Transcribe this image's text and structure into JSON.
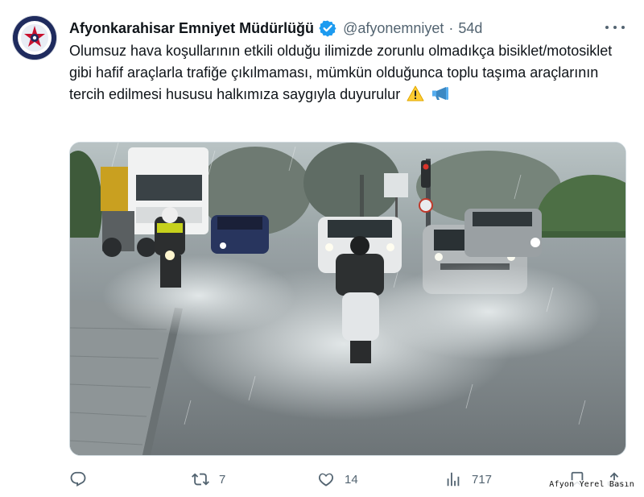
{
  "tweet": {
    "author_name": "Afyonkarahisar Emniyet Müdürlüğü",
    "author_handle": "@afyonemniyet",
    "separator": "·",
    "time": "54d",
    "text": "Olumsuz hava koşullarının etkili olduğu ilimizde zorunlu olmadıkça bisiklet/motosiklet gibi hafif araçlarla trafiğe çıkılmaması, mümkün olduğunca toplu taşıma araçlarının tercih edilmesi hususu halkımıza saygıyla duyurulur",
    "emojis": [
      "warning-emoji",
      "megaphone-emoji"
    ],
    "verified_color": "#1d9bf0",
    "photo_description_icon": "photo"
  },
  "actions": {
    "reply_count": "",
    "retweet_count": "7",
    "like_count": "14",
    "views_count": "717",
    "icons": [
      "reply-icon",
      "retweet-icon",
      "like-icon",
      "views-icon",
      "bookmark-icon",
      "share-icon"
    ]
  },
  "watermark": "Afyon Yerel Basın",
  "colors": {
    "text_primary": "#0f1419",
    "text_secondary": "#536471",
    "verified": "#1d9bf0"
  }
}
